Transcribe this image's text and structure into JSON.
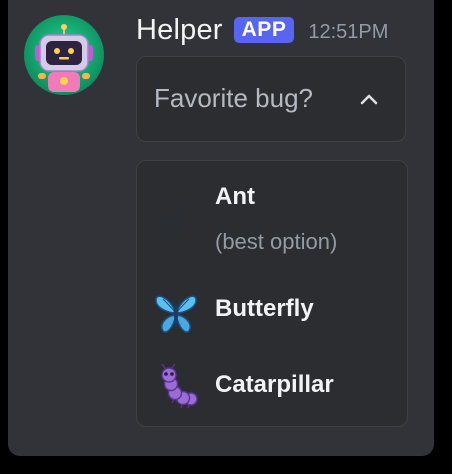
{
  "message": {
    "username": "Helper",
    "badge": "APP",
    "timestamp": "12:51PM",
    "avatar_icon": "robot-avatar"
  },
  "select": {
    "placeholder": "Favorite bug?",
    "expanded": true,
    "chevron_icon": "chevron-up-icon"
  },
  "options": [
    {
      "label": "Ant",
      "description": "(best option)",
      "icon": "ant-emoji"
    },
    {
      "label": "Butterfly",
      "description": "",
      "icon": "butterfly-emoji"
    },
    {
      "label": "Catarpillar",
      "description": "",
      "icon": "caterpillar-emoji"
    }
  ],
  "colors": {
    "background": "#313338",
    "badge": "#5865f2",
    "menu_bg": "#2b2d31",
    "border": "#3f4147",
    "text_primary": "#f2f3f5",
    "text_muted": "#949ba4"
  }
}
